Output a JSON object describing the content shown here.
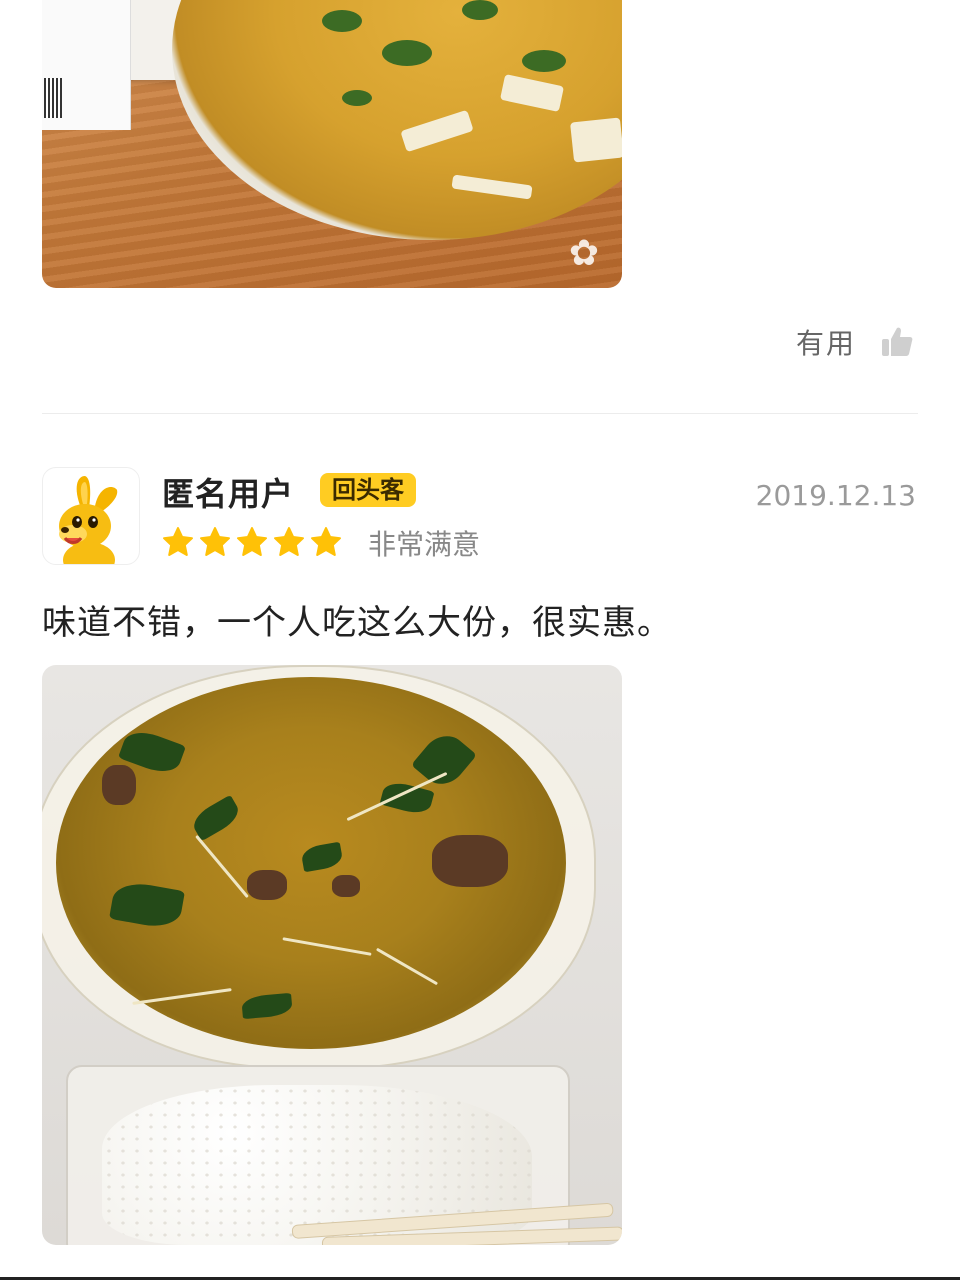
{
  "previous_review": {
    "useful_label": "有用",
    "icons": {
      "useful": "thumbs-up-icon"
    }
  },
  "review": {
    "user": {
      "name": "匿名用户",
      "badge": "回头客",
      "avatar": "kangaroo-mascot-avatar"
    },
    "date": "2019.12.13",
    "rating": {
      "stars": 5,
      "max": 5,
      "text": "非常满意"
    },
    "text": "味道不错，一个人吃这么大份，很实惠。"
  },
  "colors": {
    "badge_bg": "#ffcc22",
    "star": "#ffc107",
    "muted_text": "#888888",
    "divider": "#ececec"
  }
}
